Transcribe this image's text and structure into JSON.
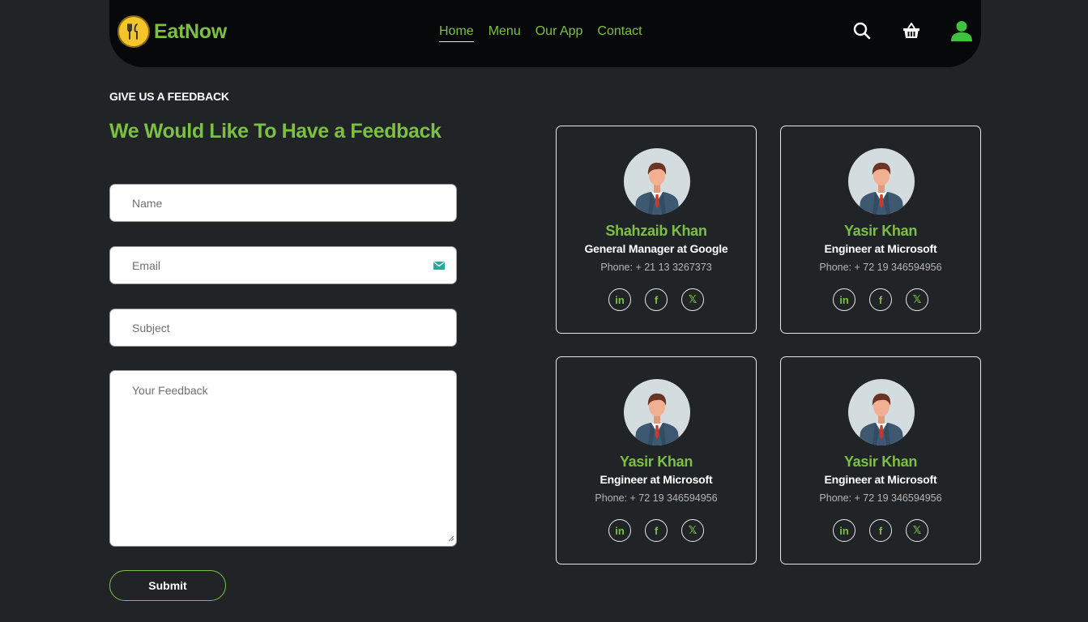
{
  "brand": {
    "name": "EatNow",
    "logo_icon": "fork-knife-icon"
  },
  "nav": {
    "links": [
      {
        "label": "Home",
        "active": true
      },
      {
        "label": "Menu",
        "active": false
      },
      {
        "label": "Our App",
        "active": false
      },
      {
        "label": "Contact",
        "active": false
      }
    ],
    "icons": [
      "search-icon",
      "basket-icon",
      "user-icon"
    ]
  },
  "section": {
    "eyebrow": "GIVE US A FEEDBACK",
    "headline": "We Would Like To Have a Feedback"
  },
  "form": {
    "name_placeholder": "Name",
    "email_placeholder": "Email",
    "subject_placeholder": "Subject",
    "feedback_placeholder": "Your Feedback",
    "submit_label": "Submit"
  },
  "contacts": [
    {
      "name": "Shahzaib Khan",
      "role": "General Manager at Google",
      "phone": "Phone: + 21 13 3267373"
    },
    {
      "name": "Yasir Khan",
      "role": "Engineer at Microsoft",
      "phone": "Phone: + 72 19 346594956"
    },
    {
      "name": "Yasir Khan",
      "role": "Engineer at Microsoft",
      "phone": "Phone: + 72 19 346594956"
    },
    {
      "name": "Yasir Khan",
      "role": "Engineer at Microsoft",
      "phone": "Phone: + 72 19 346594956"
    }
  ],
  "socials": [
    "linkedin-icon",
    "facebook-icon",
    "x-twitter-icon"
  ],
  "colors": {
    "accent": "#7bc043",
    "background": "#212427",
    "navbar": "#070809",
    "logo": "#f4c52b"
  }
}
